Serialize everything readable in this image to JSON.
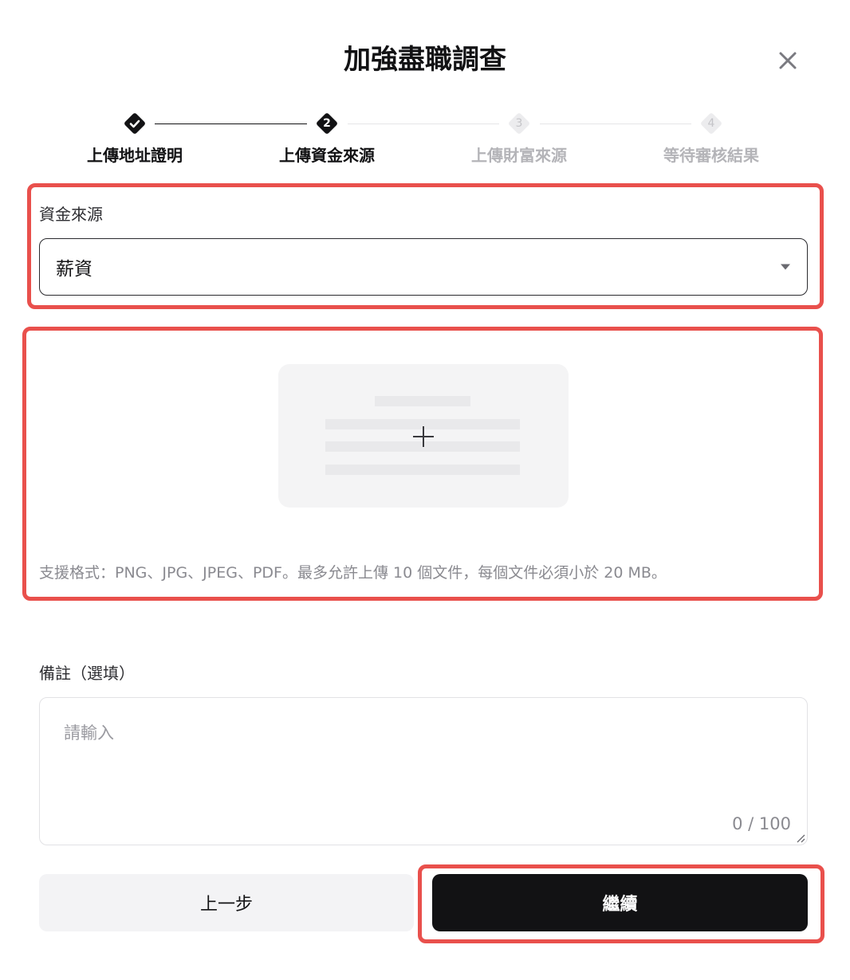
{
  "dialog": {
    "title": "加強盡職調查",
    "close_icon": "close-icon"
  },
  "stepper": {
    "steps": [
      {
        "label": "上傳地址證明",
        "status": "done",
        "number": ""
      },
      {
        "label": "上傳資金來源",
        "status": "active",
        "number": "2"
      },
      {
        "label": "上傳財富來源",
        "status": "pending",
        "number": "3"
      },
      {
        "label": "等待審核結果",
        "status": "pending",
        "number": "4"
      }
    ]
  },
  "fund_source": {
    "label": "資金來源",
    "selected": "薪資",
    "dropdown_icon": "caret-down-icon"
  },
  "upload": {
    "icon": "plus-icon",
    "hint": "支援格式：PNG、JPG、JPEG、PDF。最多允許上傳 10 個文件，每個文件必須小於 20 MB。"
  },
  "remark": {
    "label": "備註（選填）",
    "placeholder": "請輸入",
    "counter": "0 / 100"
  },
  "actions": {
    "prev_label": "上一步",
    "next_label": "繼續"
  },
  "colors": {
    "primary": "#121214",
    "highlight": "#e9504c",
    "muted": "#8a8a90",
    "surface": "#f3f3f5"
  }
}
